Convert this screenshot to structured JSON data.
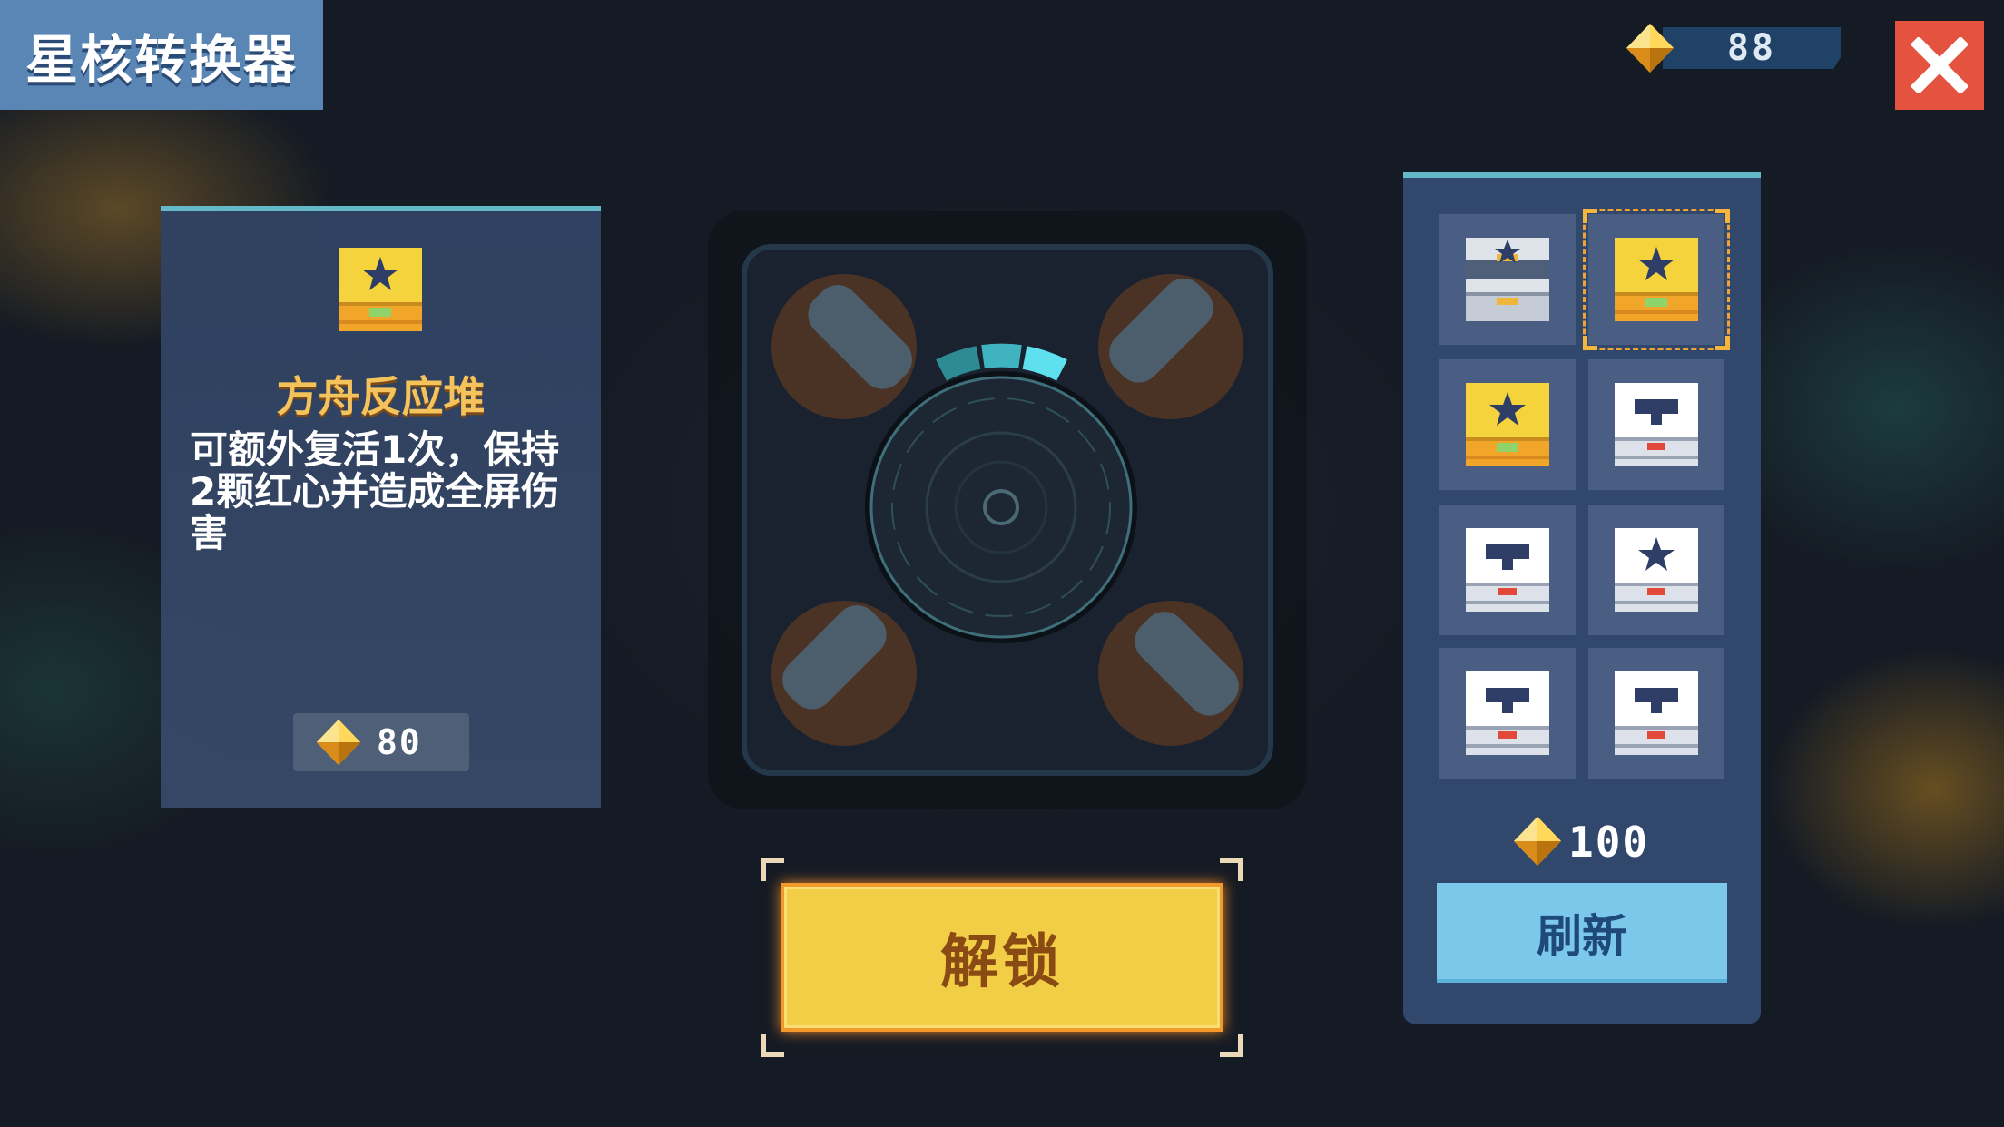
{
  "header": {
    "title": "星核转换器",
    "currency": {
      "icon": "diamond-gem-icon",
      "amount": "88"
    },
    "close_icon": "close-icon"
  },
  "selected_item": {
    "icon": "gold-star-chest-icon",
    "name": "方舟反应堆",
    "description": "可额外复活1次，保持2颗红心并造成全屏伤害",
    "price": "80"
  },
  "unlock_button": {
    "label": "解锁"
  },
  "item_grid": [
    {
      "type": "silver-star-chest",
      "selected": false
    },
    {
      "type": "gold-star-chest",
      "selected": true
    },
    {
      "type": "gold-star-chest",
      "selected": false
    },
    {
      "type": "weapon-chest",
      "selected": false
    },
    {
      "type": "weapon-chest",
      "selected": false
    },
    {
      "type": "white-star-chest",
      "selected": false
    },
    {
      "type": "weapon-chest",
      "selected": false
    },
    {
      "type": "weapon-chest",
      "selected": false
    }
  ],
  "refresh": {
    "cost": "100",
    "label": "刷新"
  },
  "colors": {
    "accent_teal": "#63b9c7",
    "title_blue": "#5a86b6",
    "close_red": "#e4533f",
    "unlock_yellow": "#f2ce47",
    "refresh_blue": "#7cc8ea",
    "item_name_gold": "#f4c35c"
  }
}
